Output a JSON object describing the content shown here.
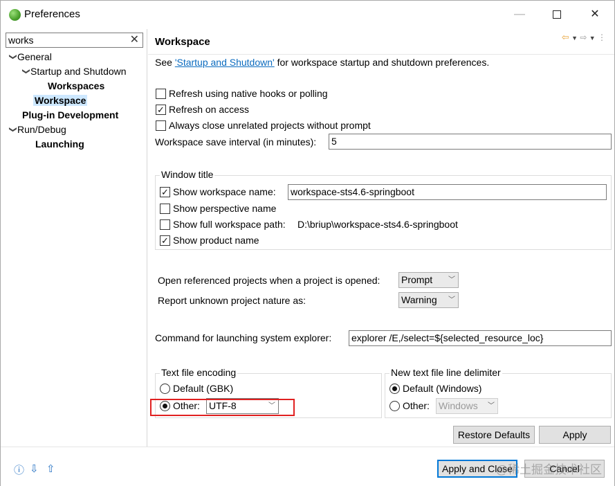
{
  "window": {
    "title": "Preferences",
    "min_glyph": "—",
    "close_glyph": "✕"
  },
  "filter": {
    "value": "works",
    "clear_glyph": "✕"
  },
  "tree": {
    "general": "General",
    "startup": "Startup and Shutdown",
    "workspaces": "Workspaces",
    "workspace": "Workspace",
    "plugin": "Plug-in Development",
    "rundebug": "Run/Debug",
    "launching": "Launching"
  },
  "page": {
    "title": "Workspace",
    "see_prefix": "See ",
    "see_link": "'Startup and Shutdown'",
    "see_suffix": " for workspace startup and shutdown preferences.",
    "refresh_native": {
      "label": "Refresh using native hooks or polling",
      "checked": false
    },
    "refresh_access": {
      "label": "Refresh on access",
      "checked": true
    },
    "always_close": {
      "label": "Always close unrelated projects without prompt",
      "checked": false
    },
    "save_interval_label": "Workspace save interval (in minutes):",
    "save_interval_value": "5",
    "window_title": {
      "legend": "Window title",
      "show_ws_name": {
        "label": "Show workspace name:",
        "checked": true,
        "value": "workspace-sts4.6-springboot"
      },
      "show_perspective": {
        "label": "Show perspective name",
        "checked": false
      },
      "show_full_path": {
        "label": "Show full workspace path:",
        "checked": false,
        "value": "D:\\briup\\workspace-sts4.6-springboot"
      },
      "show_product": {
        "label": "Show product name",
        "checked": true
      }
    },
    "open_ref_label": "Open referenced projects when a project is opened:",
    "open_ref_value": "Prompt",
    "unknown_nature_label": "Report unknown project nature as:",
    "unknown_nature_value": "Warning",
    "cmd_label": "Command for launching system explorer:",
    "cmd_value": "explorer /E,/select=${selected_resource_loc}",
    "encoding": {
      "legend": "Text file encoding",
      "default_label": "Default (GBK)",
      "other_label": "Other:",
      "other_value": "UTF-8",
      "selected": "other"
    },
    "line_delim": {
      "legend": "New text file line delimiter",
      "default_label": "Default (Windows)",
      "other_label": "Other:",
      "other_value": "Windows",
      "selected": "default"
    },
    "restore_defaults": "Restore Defaults",
    "apply": "Apply"
  },
  "footer": {
    "help_icon": "question-icon",
    "import_icon": "import-icon",
    "export_icon": "export-icon",
    "apply_close": "Apply and Close",
    "cancel": "Cancel",
    "watermark": "@稀土掘金技术社区"
  },
  "colors": {
    "selection": "#cde8ff",
    "link": "#0b6bbf",
    "highlight_box": "#e02020",
    "default_button": "#0078d7"
  }
}
